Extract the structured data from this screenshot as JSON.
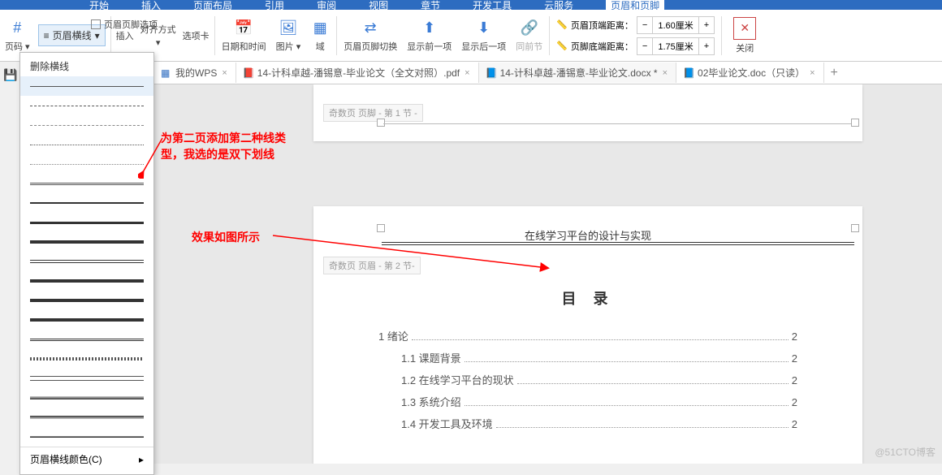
{
  "menubar": [
    "开始",
    "插入",
    "页面布局",
    "引用",
    "审阅",
    "视图",
    "章节",
    "开发工具",
    "云服务",
    "页眉和页脚"
  ],
  "ribbon": {
    "page_number": "页码",
    "header_lines": "页眉横线",
    "hf_options": "页眉页脚选项",
    "insert": "插入",
    "align": "对齐方式",
    "options_tab": "选项卡",
    "date_time": "日期和时间",
    "picture": "图片",
    "field": "域",
    "hf_switch": "页眉页脚切换",
    "show_prev": "显示前一项",
    "show_next": "显示后一项",
    "same_prev": "同前节",
    "top_dist_label": "页眉顶端距离：",
    "bottom_dist_label": "页脚底端距离：",
    "top_dist_val": "1.60厘米",
    "bottom_dist_val": "1.75厘米",
    "minus": "−",
    "plus": "+",
    "close": "关闭"
  },
  "dropdown": {
    "title": "删除横线",
    "color": "页眉横线颜色(C)",
    "arrow": "▸"
  },
  "tabs": [
    {
      "icon": "▦",
      "label": "我的WPS"
    },
    {
      "icon": "📕",
      "label": "14-计科卓越-潘锡意-毕业论文（全文对照）.pdf"
    },
    {
      "icon": "📘",
      "label": "14-计科卓越-潘锡意-毕业论文.docx *",
      "active": true
    },
    {
      "icon": "📘",
      "label": "02毕业论文.doc（只读）"
    }
  ],
  "page1_label": "奇数页 页脚 - 第 1 节 -",
  "page2_label": "奇数页 页眉 - 第 2 节-",
  "page2_title": "在线学习平台的设计与实现",
  "toc_title": "目 录",
  "toc": [
    {
      "lvl": 1,
      "t": "1 绪论",
      "p": "2"
    },
    {
      "lvl": 2,
      "t": "1.1 课题背景",
      "p": "2"
    },
    {
      "lvl": 2,
      "t": "1.2 在线学习平台的现状",
      "p": "2"
    },
    {
      "lvl": 2,
      "t": "1.3 系统介绍",
      "p": "2"
    },
    {
      "lvl": 2,
      "t": "1.4 开发工具及环境",
      "p": "2"
    }
  ],
  "anno1a": "为第二页添加第二种线类",
  "anno1b": "型，我选的是双下划线",
  "anno2": "效果如图所示",
  "watermark": "@51CTO博客"
}
